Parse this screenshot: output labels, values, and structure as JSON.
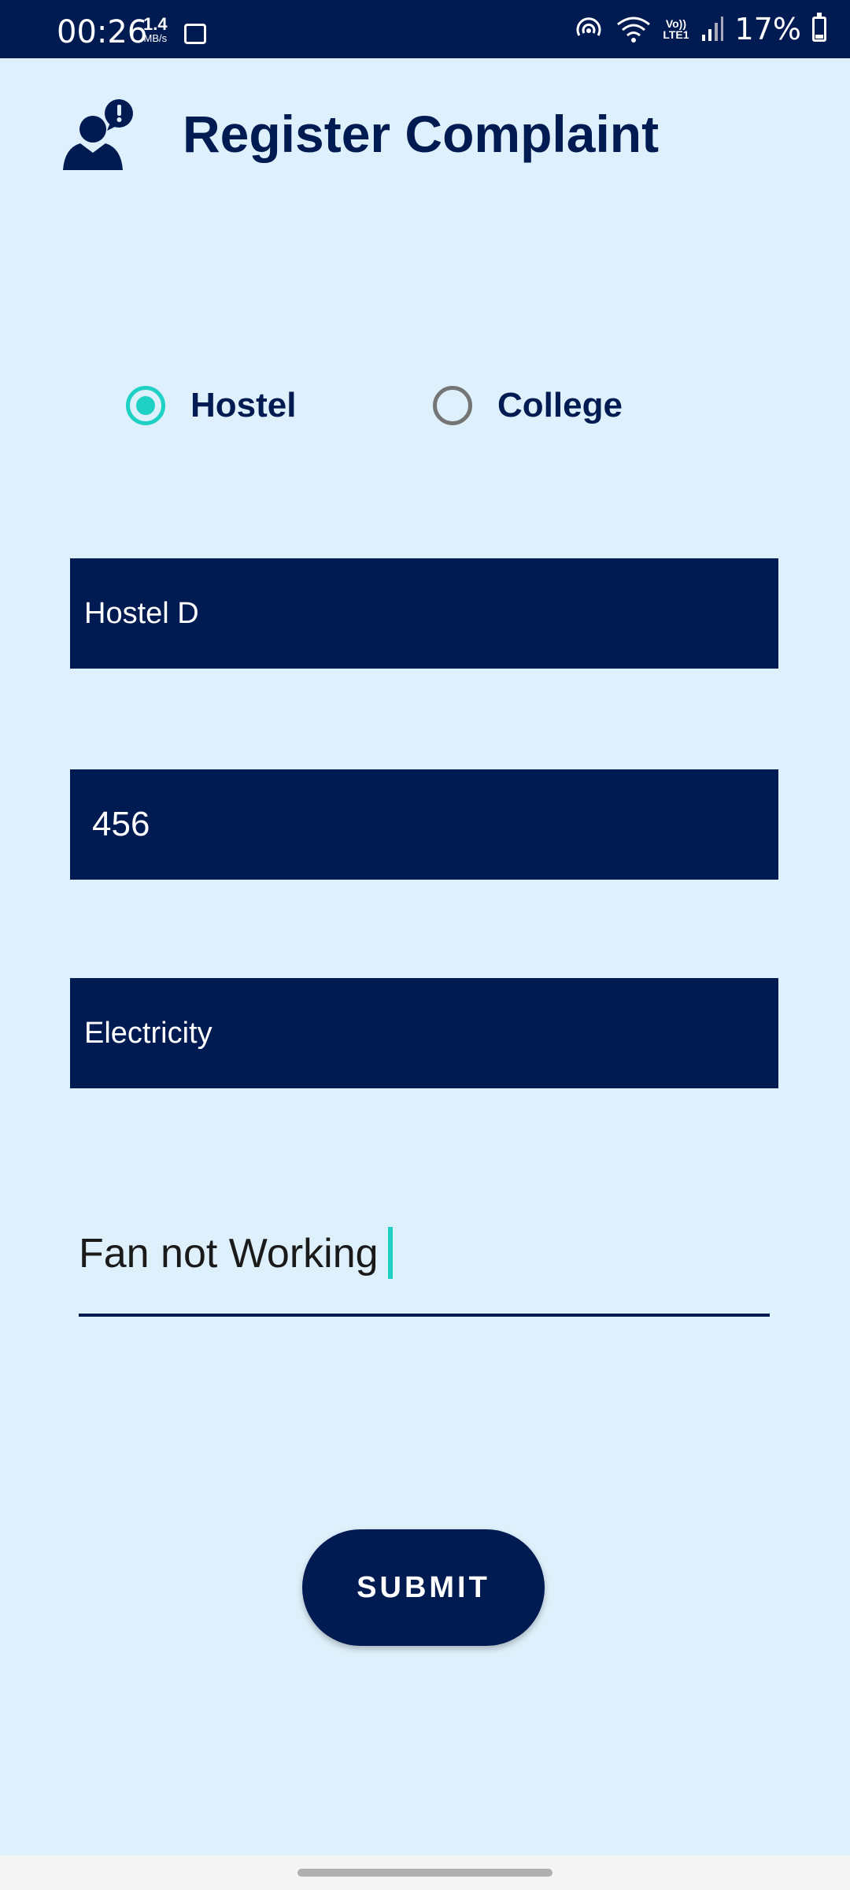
{
  "status_bar": {
    "time": "00:26",
    "net_speed_value": "1.4",
    "net_speed_unit": "MB/s",
    "volte_top": "Vo))",
    "volte_bottom": "LTE1",
    "battery": "17%"
  },
  "header": {
    "title": "Register Complaint",
    "icon": "user-alert-icon"
  },
  "location_type": {
    "options": [
      {
        "label": "Hostel",
        "selected": true
      },
      {
        "label": "College",
        "selected": false
      }
    ]
  },
  "form": {
    "hostel": "Hostel D",
    "room": "456",
    "category": "Electricity",
    "complaint": "Fan not Working"
  },
  "submit_label": "SUBMIT",
  "colors": {
    "background": "#def0fb",
    "primary": "#001a52",
    "accent": "#1fd1c4"
  }
}
